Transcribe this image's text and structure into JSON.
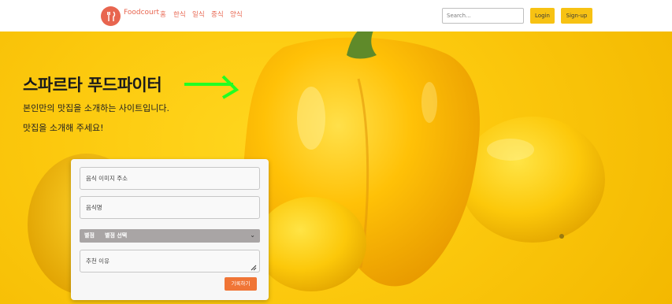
{
  "navbar": {
    "brand": "Foodcourt",
    "links": [
      "홈",
      "한식",
      "일식",
      "중식",
      "양식"
    ],
    "search_placeholder": "Search...",
    "login_label": "Login",
    "signup_label": "Sign-up"
  },
  "hero": {
    "title": "스파르타 푸드파이터",
    "subtitle1": "본인만의 맛집을 소개하는 사이트입니다.",
    "subtitle2": "맛집을 소개해 주세요!"
  },
  "form": {
    "image_url_placeholder": "음식 이미지 주소",
    "food_name_placeholder": "음식명",
    "rating_label": "별점",
    "rating_selected": "별점 선택",
    "reason_placeholder": "추천 이유",
    "submit_label": "기록하기"
  },
  "colors": {
    "brand": "#e8654f",
    "accent_yellow": "#f7c213",
    "submit": "#f07536",
    "arrow": "#22ff22"
  },
  "icons": {
    "logo": "fork-knife-icon",
    "select": "chevron-down-icon",
    "hero_arrow": "arrow-right-icon"
  }
}
